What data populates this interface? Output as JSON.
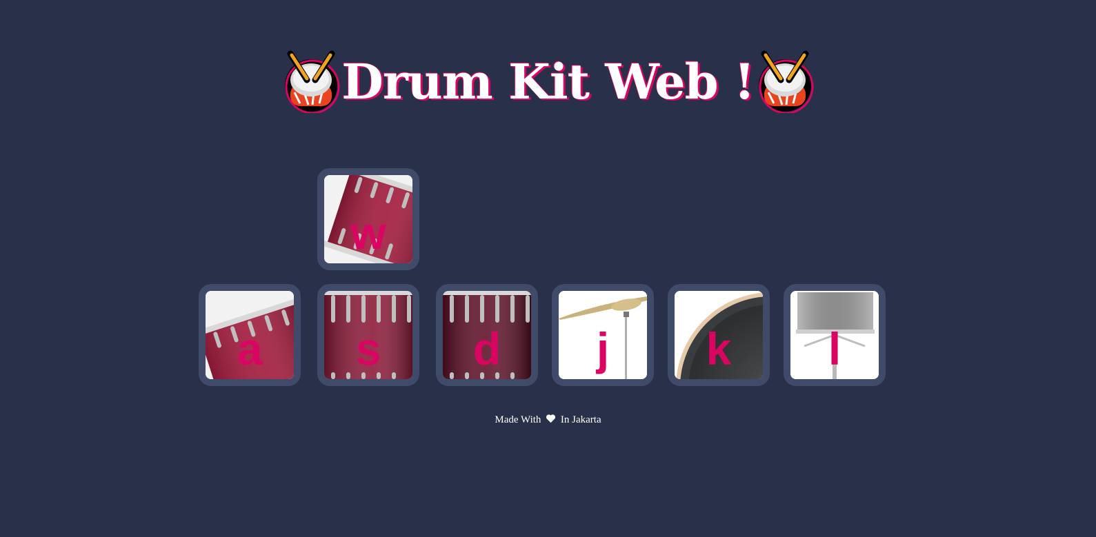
{
  "header": {
    "title": "Drum Kit Web !",
    "left_icon": "drum-icon",
    "right_icon": "drum-icon"
  },
  "keys": [
    {
      "letter": "w",
      "instrument": "tom-1"
    },
    {
      "letter": "a",
      "instrument": "tom-2"
    },
    {
      "letter": "s",
      "instrument": "tom-3"
    },
    {
      "letter": "d",
      "instrument": "tom-4"
    },
    {
      "letter": "j",
      "instrument": "crash"
    },
    {
      "letter": "k",
      "instrument": "kick"
    },
    {
      "letter": "l",
      "instrument": "snare"
    }
  ],
  "footer": {
    "before": "Made With",
    "icon": "heart-icon",
    "after": "In Jakarta"
  },
  "colors": {
    "background": "#283149",
    "key_border": "#404b69",
    "accent": "#da0463",
    "text": "#ffffff"
  }
}
